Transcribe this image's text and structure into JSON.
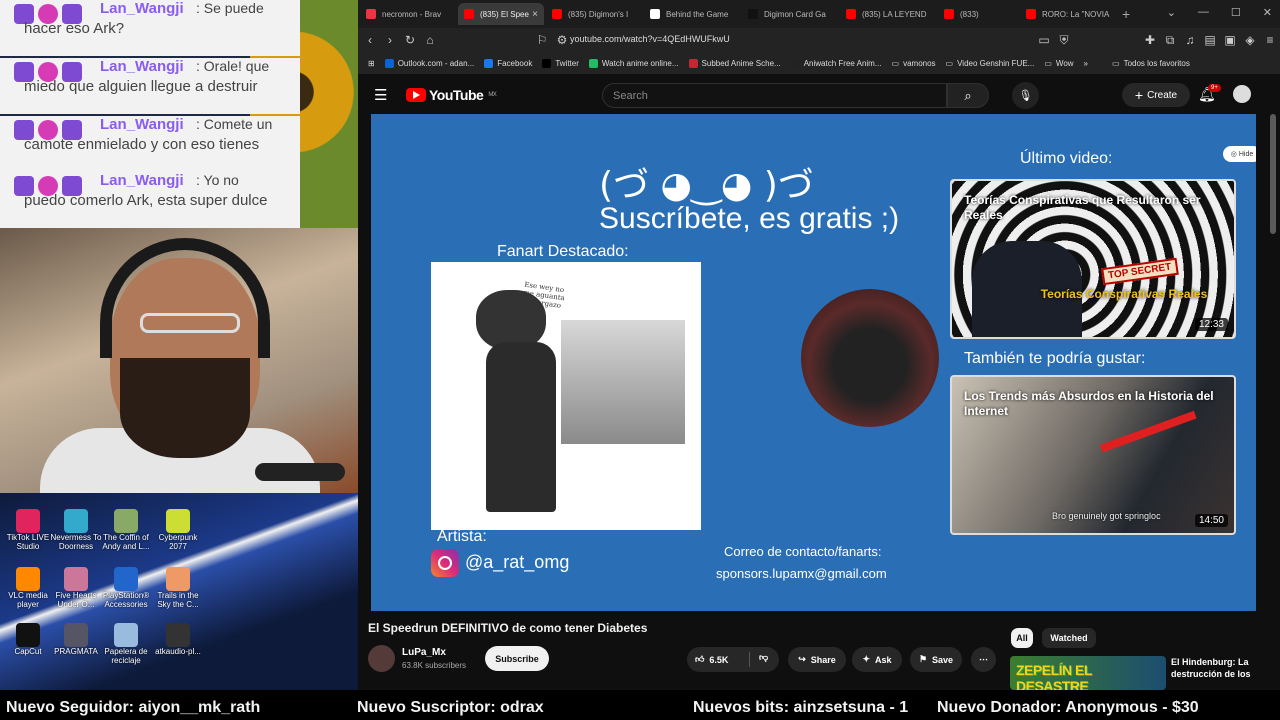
{
  "chat": [
    {
      "user": "Lan_Wangji",
      "msg1": ": Se puede",
      "msg2": "hacer eso Ark?"
    },
    {
      "user": "Lan_Wangji",
      "msg1": ": Orale! que",
      "msg2": "miedo que alguien llegue a destruir"
    },
    {
      "user": "Lan_Wangji",
      "msg1": ": Comete un",
      "msg2": "camote enmielado y con eso tienes"
    },
    {
      "user": "Lan_Wangji",
      "msg1": ": Yo no",
      "msg2": "puedo comerlo Ark, esta super dulce"
    }
  ],
  "desktop_icons": [
    {
      "label": "TikTok LIVE Studio",
      "color": "#e0245e"
    },
    {
      "label": "Nevermess To Doorness",
      "color": "#3ac"
    },
    {
      "label": "The Coffin of Andy and L...",
      "color": "#8a6"
    },
    {
      "label": "Cyberpunk 2077",
      "color": "#cd3"
    },
    {
      "label": "VLC media player",
      "color": "#f80"
    },
    {
      "label": "Five Hearts Under O...",
      "color": "#c79"
    },
    {
      "label": "PlayStation® Accessories",
      "color": "#26c"
    },
    {
      "label": "Trails in the Sky the C...",
      "color": "#e96"
    },
    {
      "label": "CapCut",
      "color": "#111"
    },
    {
      "label": "PRAGMATA",
      "color": "#556"
    },
    {
      "label": "Papelera de reciclaje",
      "color": "#9bd"
    },
    {
      "label": "atkaudio-pl...",
      "color": "#333"
    }
  ],
  "browser": {
    "tabs": [
      {
        "label": "necromon - Brav",
        "color": "#e34",
        "active": false
      },
      {
        "label": "(835) El Spee",
        "color": "#f00",
        "active": true
      },
      {
        "label": "(835) Digimon's I",
        "color": "#f00",
        "active": false
      },
      {
        "label": "Behind the Game",
        "color": "#fff",
        "active": false
      },
      {
        "label": "Digimon Card Ga",
        "color": "#111",
        "active": false
      },
      {
        "label": "(835) LA LEYEND",
        "color": "#f00",
        "active": false
      },
      {
        "label": "(833)",
        "color": "#f00",
        "active": false
      },
      {
        "label": "RORO: La \"NOVIA",
        "color": "#f00",
        "active": false
      }
    ],
    "url": "youtube.com/watch?v=4QEdHWUFkwU",
    "bookmarks": [
      {
        "label": "Outlook.com - adan...",
        "color": "#0a64d8"
      },
      {
        "label": "Facebook",
        "color": "#1877f2"
      },
      {
        "label": "Twitter",
        "color": "#000"
      },
      {
        "label": "Watch anime online...",
        "color": "#2b6"
      },
      {
        "label": "Subbed Anime Sche...",
        "color": "#c23"
      },
      {
        "label": "Aniwatch Free Anim...",
        "color": "#222"
      },
      {
        "label": "vamonos",
        "color": "#888"
      },
      {
        "label": "Video Genshin FUE...",
        "color": "#888"
      },
      {
        "label": "Wow",
        "color": "#888"
      },
      {
        "label": "Todos los favoritos",
        "color": "#888"
      }
    ]
  },
  "youtube": {
    "logo": "YouTube",
    "region": "MX",
    "search_placeholder": "Search",
    "create_label": "Create",
    "notif_count": "9+",
    "player": {
      "kaomoji": "(づ ◕‿◕ )づ",
      "subscribe_text": "Suscríbete, es gratis ;)",
      "fanart_title": "Fanart Destacado:",
      "fanart_note": "Ese wey no me aguanta un vergazo",
      "artist_label": "Artista:",
      "artist_handle": "@a_rat_omg",
      "contact_label": "Correo de contacto/fanarts:",
      "contact_email": "sponsors.lupamx@gmail.com",
      "ultimo_label": "Último video:",
      "hide_label": "Hide",
      "tambien_label": "También te podría gustar:",
      "card1": {
        "title": "Teorías Conspirativas que Resultaron ser Reales",
        "stamp": "TOP SECRET",
        "overlay": "Teorías Conspirativas Reales",
        "duration": "12:33"
      },
      "card2": {
        "title": "Los Trends más Absurdos en la Historia del Internet",
        "caption": "Bro genuinely got springloc",
        "duration": "14:50"
      }
    },
    "video_title": "El Speedrun DEFINITIVO de como tener Diabetes",
    "channel_name": "LuPa_Mx",
    "channel_subs": "63.8K subscribers",
    "subscribe_button": "Subscribe",
    "likes": "6.5K",
    "share_label": "Share",
    "ask_label": "Ask",
    "save_label": "Save",
    "chip_all": "All",
    "chip_watched": "Watched",
    "rec": {
      "thumb_text": "ZEPELÍN EL DESASTRE",
      "title": "El Hindenburg: La destrucción de los"
    }
  },
  "ticker": {
    "follower": "Nuevo Seguidor: aiyon__mk_rath",
    "subscriber": "Nuevo Suscriptor: odrax",
    "bits": "Nuevos bits: ainzsetsuna - 1",
    "donor": "Nuevo Donador: Anonymous - $30"
  }
}
